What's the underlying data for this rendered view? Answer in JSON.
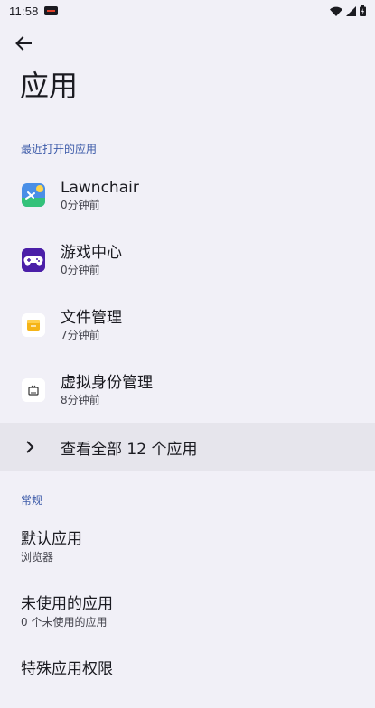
{
  "status_bar": {
    "time": "11:58",
    "icons": [
      "notification-icon",
      "wifi-icon",
      "signal-icon",
      "battery-icon"
    ]
  },
  "header": {
    "back_icon": "arrow-back-icon",
    "title": "应用"
  },
  "recent": {
    "section_label": "最近打开的应用",
    "apps": [
      {
        "name": "Lawnchair",
        "time": "0分钟前",
        "icon": "lawnchair-icon"
      },
      {
        "name": "游戏中心",
        "time": "0分钟前",
        "icon": "gamepad-icon"
      },
      {
        "name": "文件管理",
        "time": "7分钟前",
        "icon": "folder-icon"
      },
      {
        "name": "虚拟身份管理",
        "time": "8分钟前",
        "icon": "tv-icon"
      }
    ],
    "see_all_label": "查看全部 12 个应用"
  },
  "general": {
    "section_label": "常规",
    "items": [
      {
        "title": "默认应用",
        "subtitle": "浏览器"
      },
      {
        "title": "未使用的应用",
        "subtitle": "0 个未使用的应用"
      },
      {
        "title": "特殊应用权限",
        "subtitle": ""
      }
    ]
  },
  "colors": {
    "background": "#f1f0f7",
    "accent": "#3d5ba9",
    "highlight_row": "#e6e5ec"
  }
}
